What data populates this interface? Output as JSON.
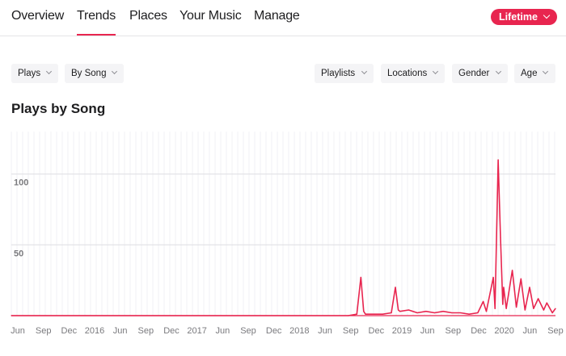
{
  "nav": {
    "tabs": [
      {
        "label": "Overview"
      },
      {
        "label": "Trends"
      },
      {
        "label": "Places"
      },
      {
        "label": "Your Music"
      },
      {
        "label": "Manage"
      }
    ],
    "active_tab": "Trends",
    "range_label": "Lifetime"
  },
  "filters": {
    "left": [
      "Plays",
      "By Song"
    ],
    "right": [
      "Playlists",
      "Locations",
      "Gender",
      "Age"
    ]
  },
  "chart_title": "Plays by Song",
  "colors": {
    "accent": "#e8254f",
    "grid": "#dedee2"
  },
  "chart_data": {
    "type": "line",
    "title": "Plays by Song",
    "xlabel": "",
    "ylabel": "",
    "y_ticks": [
      50,
      100
    ],
    "ylim": [
      0,
      130
    ],
    "grid": true,
    "x_tick_labels": [
      "Jun",
      "Sep",
      "Dec",
      "2016",
      "Jun",
      "Sep",
      "Dec",
      "2017",
      "Jun",
      "Sep",
      "Dec",
      "2018",
      "Jun",
      "Sep",
      "Dec",
      "2019",
      "Jun",
      "Sep",
      "Dec",
      "2020",
      "Jun",
      "Sep"
    ],
    "x_range": [
      "2015-06",
      "2020-09"
    ],
    "series": [
      {
        "points": [
          [
            "2015-06",
            0
          ],
          [
            "2018-09",
            0
          ],
          [
            "2018-10",
            1
          ],
          [
            "2018-10-15",
            27
          ],
          [
            "2018-10-25",
            3
          ],
          [
            "2018-11",
            1
          ],
          [
            "2018-12",
            1
          ],
          [
            "2019-01",
            1
          ],
          [
            "2019-02",
            2
          ],
          [
            "2019-02-15",
            20
          ],
          [
            "2019-02-25",
            4
          ],
          [
            "2019-03",
            3
          ],
          [
            "2019-04",
            4
          ],
          [
            "2019-05",
            2
          ],
          [
            "2019-06",
            3
          ],
          [
            "2019-07",
            2
          ],
          [
            "2019-08",
            3
          ],
          [
            "2019-09",
            2
          ],
          [
            "2019-10",
            2
          ],
          [
            "2019-11",
            1
          ],
          [
            "2019-12",
            2
          ],
          [
            "2019-12-20",
            10
          ],
          [
            "2020-01",
            3
          ],
          [
            "2020-01-25",
            27
          ],
          [
            "2020-02",
            5
          ],
          [
            "2020-02-12",
            110
          ],
          [
            "2020-02-20",
            55
          ],
          [
            "2020-02-28",
            8
          ],
          [
            "2020-03",
            20
          ],
          [
            "2020-03-10",
            5
          ],
          [
            "2020-04",
            32
          ],
          [
            "2020-04-15",
            6
          ],
          [
            "2020-05",
            26
          ],
          [
            "2020-05-15",
            4
          ],
          [
            "2020-06",
            20
          ],
          [
            "2020-06-15",
            5
          ],
          [
            "2020-07",
            12
          ],
          [
            "2020-07-20",
            4
          ],
          [
            "2020-08",
            9
          ],
          [
            "2020-08-20",
            2
          ],
          [
            "2020-09",
            5
          ]
        ]
      }
    ]
  }
}
